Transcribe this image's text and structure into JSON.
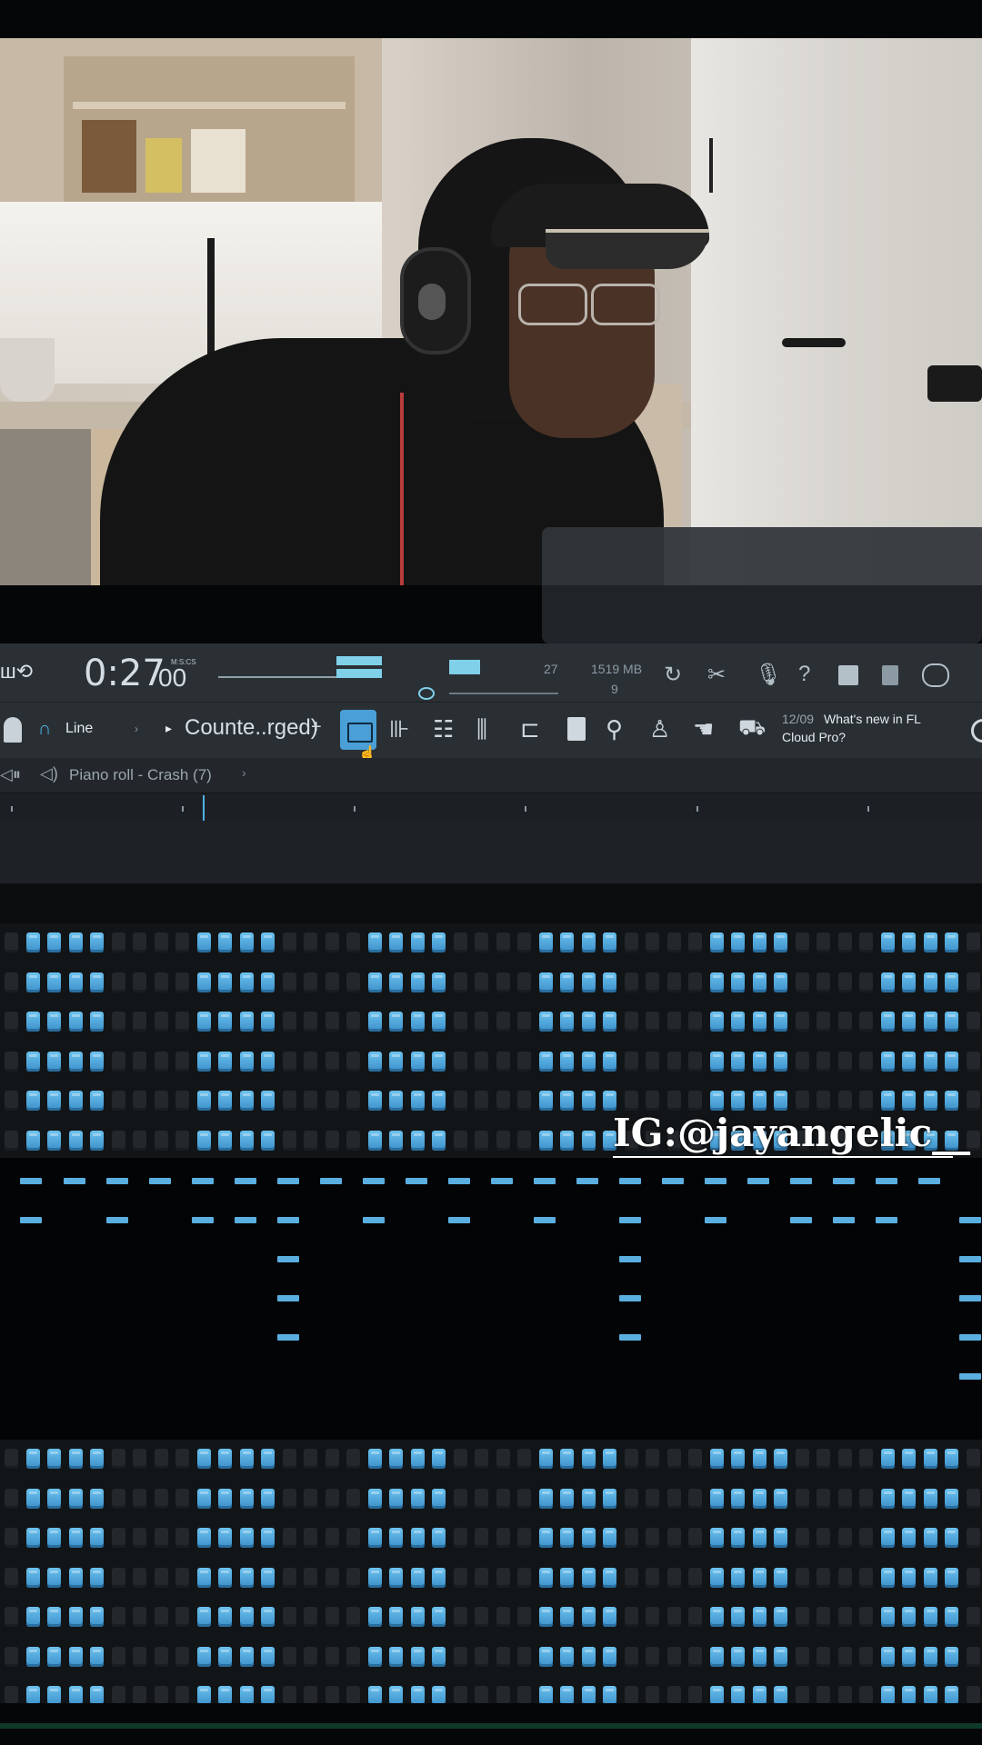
{
  "transport": {
    "time_main": "0:27",
    "time_sub": "00",
    "time_units": "M:S:CS",
    "cpu_number": "27",
    "memory": "1519 MB",
    "polyphony": "9"
  },
  "toolbar": {
    "snap_mode": "Line",
    "pattern_name": "Counte..rged)",
    "add_symbol": "+",
    "news_date": "12/09",
    "news_text_line1": "What's new in FL",
    "news_text_line2": "Cloud Pro?"
  },
  "piano_roll": {
    "title": "Piano roll - Crash (7)"
  },
  "overlay": {
    "watermark": "IG:@jayangelic__"
  },
  "colors": {
    "accent": "#5aaee0",
    "step_on": "#4a9fd6",
    "toolbar_bg": "#2a2f34"
  },
  "icons": [
    "loop-icon",
    "metronome-icon",
    "headphones-icon",
    "play-arrow-icon",
    "piano-roll-icon",
    "step-sequencer-icon",
    "playlist-icon",
    "mixer-icon",
    "browser-icon",
    "project-icon",
    "plugin-icon",
    "tuner-icon",
    "hand-icon",
    "cart-icon",
    "undo-icon",
    "cut-icon",
    "mic-icon",
    "help-icon",
    "save-icon",
    "save-as-icon",
    "chat-icon"
  ],
  "step_rows_top": 6,
  "step_rows_bottom": 7
}
